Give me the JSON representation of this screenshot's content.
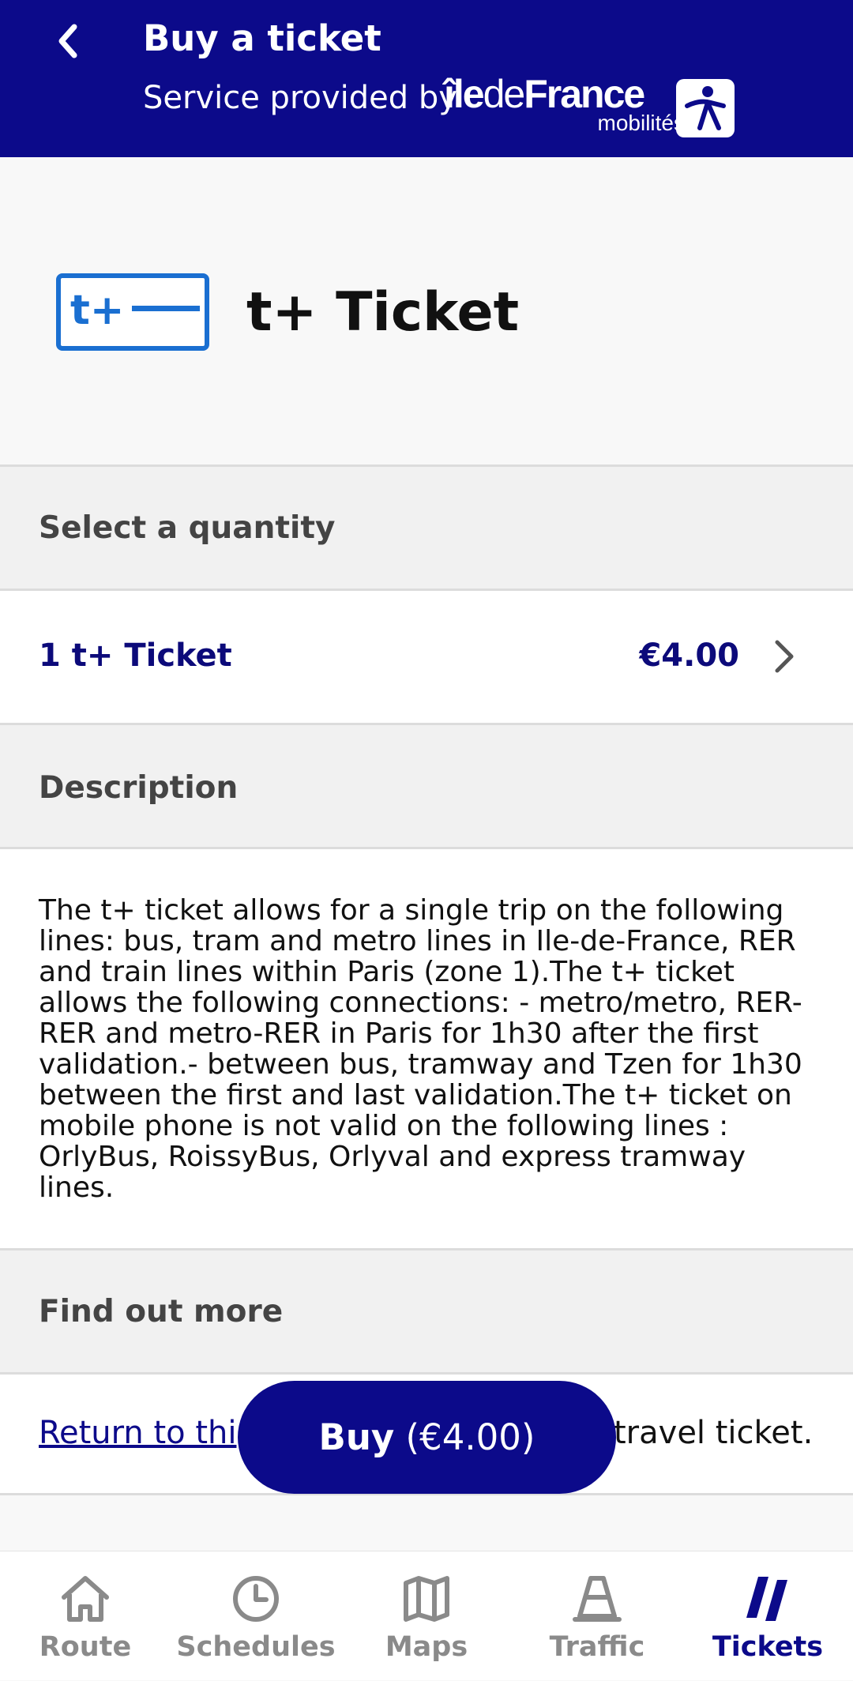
{
  "header": {
    "title": "Buy a ticket",
    "subtitle": "Service provided by",
    "logo": {
      "ile": "île",
      "de": "de",
      "france": "France",
      "mobilites": "mobilités"
    }
  },
  "product": {
    "icon_text": "t+",
    "title": "t+ Ticket"
  },
  "quantity": {
    "heading": "Select a quantity",
    "label": "1 t+ Ticket",
    "price": "€4.00"
  },
  "description": {
    "heading": "Description",
    "text": "The t+ ticket allows for a single trip on the following lines: bus, tram and metro lines in Ile-de-France, RER and train lines within Paris (zone 1).The t+ ticket allows the following connections: - metro/metro, RER-RER and metro-RER in Paris for 1h30 after the first validation.- between bus, tramway and Tzen for 1h30 between the first and last validation.The t+ ticket on mobile phone is not valid on the following lines : OrlyBus, RoissyBus, Orlyval and express tramway lines."
  },
  "find_out_more": {
    "heading": "Find out more",
    "link_text": "Return to thi",
    "trailing_text": "travel ticket."
  },
  "buy_button": {
    "label": "Buy",
    "price": "(€4.00)"
  },
  "bottom_nav": {
    "items": [
      {
        "label": "Route",
        "icon": "house-icon",
        "active": false
      },
      {
        "label": "Schedules",
        "icon": "clock-icon",
        "active": false
      },
      {
        "label": "Maps",
        "icon": "map-icon",
        "active": false
      },
      {
        "label": "Traffic",
        "icon": "traffic-cone-icon",
        "active": false
      },
      {
        "label": "Tickets",
        "icon": "tickets-icon",
        "active": true
      }
    ]
  },
  "colors": {
    "brand_navy": "#0c0a8a",
    "ticket_blue": "#1a6fd1",
    "inactive_gray": "#8a8a8a"
  }
}
